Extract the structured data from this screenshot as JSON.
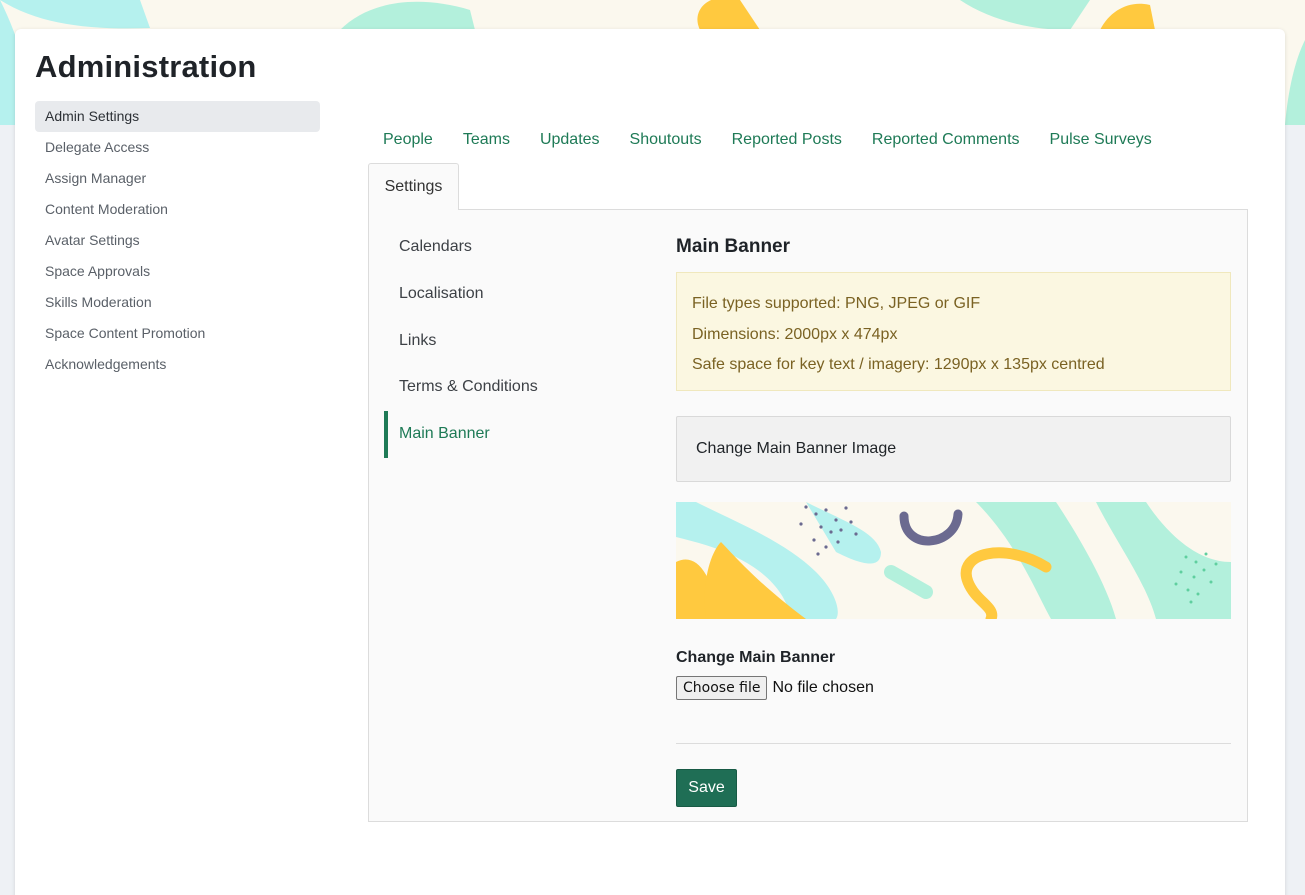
{
  "page": {
    "title": "Administration"
  },
  "sidebar": {
    "items": [
      {
        "label": "Admin Settings",
        "active": true
      },
      {
        "label": "Delegate Access"
      },
      {
        "label": "Assign Manager"
      },
      {
        "label": "Content Moderation"
      },
      {
        "label": "Avatar Settings"
      },
      {
        "label": "Space Approvals"
      },
      {
        "label": "Skills Moderation"
      },
      {
        "label": "Space Content Promotion"
      },
      {
        "label": "Acknowledgements"
      }
    ]
  },
  "tabs": {
    "items": [
      "People",
      "Teams",
      "Updates",
      "Shoutouts",
      "Reported Posts",
      "Reported Comments",
      "Pulse Surveys"
    ],
    "active": "Settings"
  },
  "settings_menu": {
    "items": [
      "Calendars",
      "Localisation",
      "Links",
      "Terms & Conditions",
      "Main Banner"
    ],
    "active": "Main Banner"
  },
  "main_banner": {
    "title": "Main Banner",
    "info": [
      "File types supported: PNG, JPEG or GIF",
      "Dimensions: 2000px x 474px",
      "Safe space for key text / imagery: 1290px x 135px centred"
    ],
    "change_image_label": "Change Main Banner Image",
    "upload_label": "Change Main Banner",
    "choose_file_button": "Choose file",
    "file_status": "No file chosen",
    "save_button": "Save"
  },
  "colors": {
    "accent": "#1e7a56",
    "save_button": "#1f6e55",
    "info_bg": "#fbf7e1",
    "info_text": "#7a6223",
    "banner_mint": "#b3f0dc",
    "banner_cyan": "#b5f1ee",
    "banner_yellow": "#ffc93f",
    "banner_purple": "#6b6a90"
  }
}
